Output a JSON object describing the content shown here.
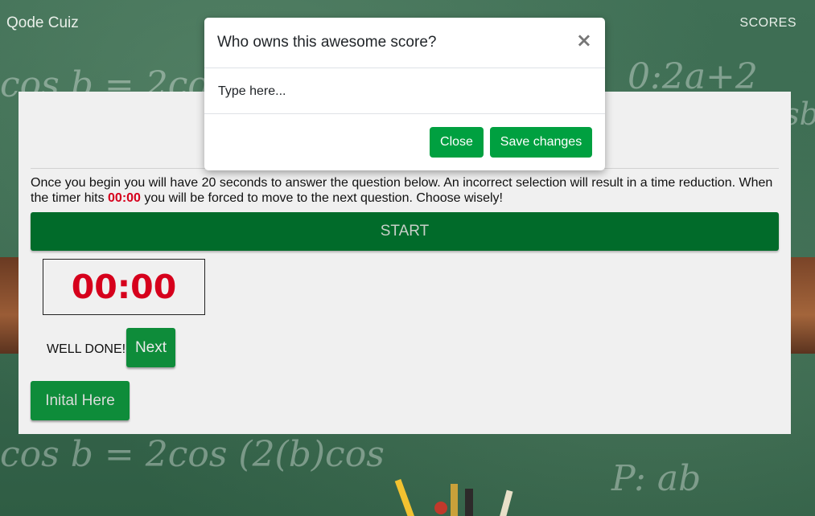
{
  "navbar": {
    "brand": "Qode Cuiz",
    "scores_link": "SCORES"
  },
  "quiz": {
    "instructions_part1": "Once you begin you will have 20 seconds to answer the question below. An incorrect selection will result in a time reduction. When the timer hits ",
    "instructions_timer": "00:00",
    "instructions_part2": " you will be forced to move to the next question. Choose wisely!",
    "start_label": "START",
    "timer_value": "00:00",
    "feedback_text": "WELL DONE!",
    "next_label": "Next",
    "initial_label": "Inital Here"
  },
  "modal": {
    "title": "Who owns this awesome score?",
    "close_x": "×",
    "input_placeholder": "Type here...",
    "close_label": "Close",
    "save_label": "Save changes"
  },
  "background": {
    "chalk_1": "cos b = 2cos",
    "chalk_2": "0:2a+2",
    "chalk_3": "cosb",
    "chalk_4": "cos b = 2cos (2(b)cos",
    "chalk_5": "P: ab"
  },
  "colors": {
    "accent_green": "#00a040",
    "dark_green": "#016b2a",
    "timer_red": "#d6001c"
  }
}
